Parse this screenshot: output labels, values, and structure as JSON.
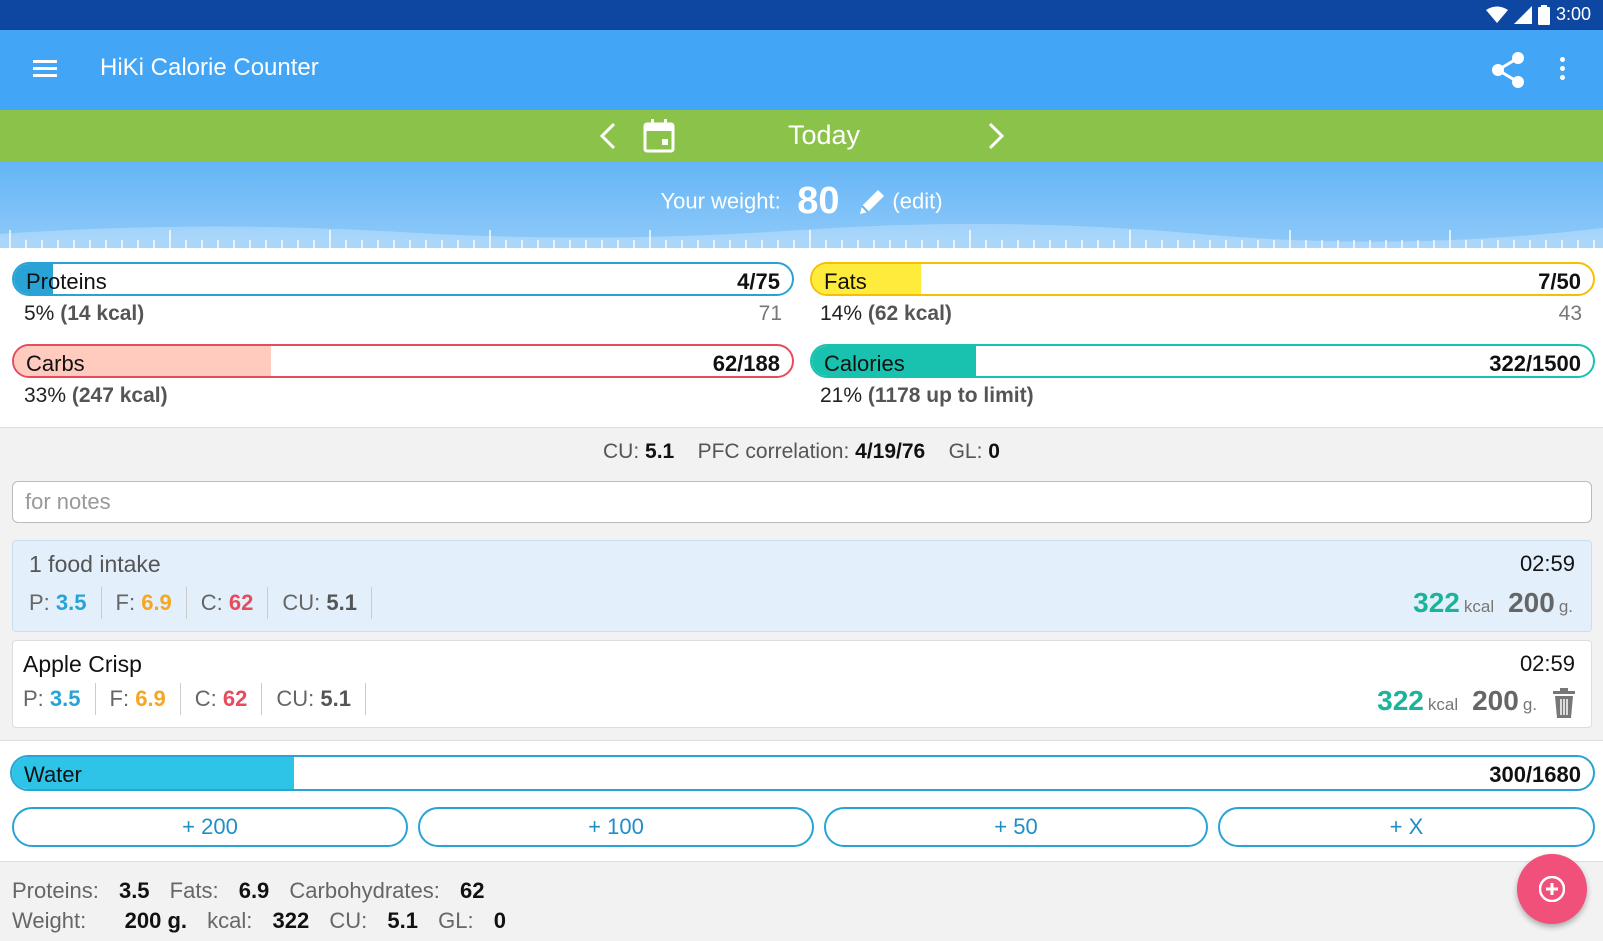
{
  "status_bar": {
    "time": "3:00"
  },
  "app_bar": {
    "title": "HiKi Calorie Counter"
  },
  "date_nav": {
    "label": "Today"
  },
  "weight": {
    "label": "Your weight:",
    "value": "80",
    "edit_label": "(edit)"
  },
  "nutrients": {
    "proteins": {
      "name": "Proteins",
      "value": "4/75",
      "fraction": 0.05,
      "percent": "5%",
      "kcal": "(14 kcal)",
      "remaining": "71",
      "color": "#29a3d6"
    },
    "fats": {
      "name": "Fats",
      "value": "7/50",
      "fraction": 0.14,
      "percent": "14%",
      "kcal": "(62 kcal)",
      "remaining": "43",
      "color": "#ffeb3b"
    },
    "carbs": {
      "name": "Carbs",
      "value": "62/188",
      "fraction": 0.33,
      "percent": "33%",
      "kcal": "(247 kcal)",
      "color": "#ffcbbf"
    },
    "calories": {
      "name": "Calories",
      "value": "322/1500",
      "fraction": 0.21,
      "percent": "21%",
      "limit_text": "(1178 up to limit)",
      "color": "#19c2ae"
    }
  },
  "summary": {
    "cu_label": "CU:",
    "cu_value": "5.1",
    "pfc_label": "PFC correlation:",
    "pfc_p": "4",
    "pfc_f": "19",
    "pfc_c": "76",
    "gl_label": "GL:",
    "gl_value": "0"
  },
  "notes": {
    "placeholder": "for notes"
  },
  "intake": {
    "title": "1 food intake",
    "time": "02:59",
    "p_label": "P:",
    "p": "3.5",
    "f_label": "F:",
    "f": "6.9",
    "c_label": "C:",
    "c": "62",
    "cu_label": "CU:",
    "cu": "5.1",
    "kcal": "322",
    "kcal_unit": "kcal",
    "grams": "200",
    "grams_unit": "g."
  },
  "food_item": {
    "name": "Apple Crisp",
    "time": "02:59",
    "p_label": "P:",
    "p": "3.5",
    "f_label": "F:",
    "f": "6.9",
    "c_label": "C:",
    "c": "62",
    "cu_label": "CU:",
    "cu": "5.1",
    "kcal": "322",
    "kcal_unit": "kcal",
    "grams": "200",
    "grams_unit": "g."
  },
  "water": {
    "name": "Water",
    "value": "300/1680",
    "fraction": 0.1786,
    "buttons": [
      "+ 200",
      "+ 100",
      "+ 50",
      "+ X"
    ]
  },
  "totals": {
    "proteins_label": "Proteins:",
    "proteins": "3.5",
    "fats_label": "Fats:",
    "fats": "6.9",
    "carbs_label": "Carbohydrates:",
    "carbs": "62",
    "weight_label": "Weight:",
    "weight": "200 g.",
    "kcal_label": "kcal:",
    "kcal": "322",
    "cu_label": "CU:",
    "cu": "5.1",
    "gl_label": "GL:",
    "gl": "0"
  },
  "colors": {
    "app_bar": "#42a5f5",
    "date_bar": "#8bc34a",
    "status_bar": "#0d47a1",
    "fab": "#f0507a",
    "teal": "#1bb39a",
    "blue": "#29a3d6",
    "orange": "#f5a623",
    "red": "#e74c5c"
  },
  "icons": [
    "menu-icon",
    "share-icon",
    "more-vert-icon",
    "chevron-left-icon",
    "calendar-icon",
    "chevron-right-icon",
    "pencil-icon",
    "trash-icon",
    "add-icon",
    "wifi-icon",
    "signal-icon",
    "battery-icon"
  ]
}
